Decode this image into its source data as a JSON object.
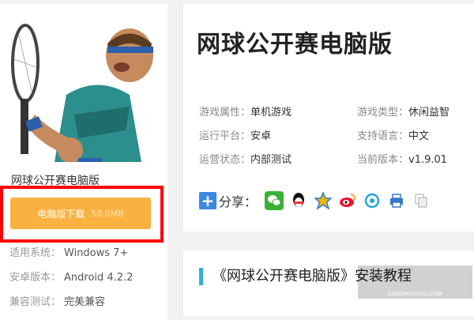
{
  "game": {
    "name": "网球公开赛电脑版",
    "download_label": "电脑版下载",
    "download_size": "50.0MB"
  },
  "side_info": [
    {
      "key": "适用系统：",
      "value": "Windows 7+"
    },
    {
      "key": "安卓版本：",
      "value": "Android 4.2.2"
    },
    {
      "key": "兼容测试：",
      "value": "完美兼容"
    }
  ],
  "header": {
    "title": "网球公开赛电脑版"
  },
  "attributes": [
    {
      "key": "游戏属性：",
      "value": "单机游戏"
    },
    {
      "key": "游戏类型：",
      "value": "休闲益智"
    },
    {
      "key": "运行平台：",
      "value": "安卓"
    },
    {
      "key": "支持语言：",
      "value": "中文"
    },
    {
      "key": "运营状态：",
      "value": "内部测试"
    },
    {
      "key": "当前版本：",
      "value": "v1.9.01"
    }
  ],
  "share": {
    "label": "分享：",
    "icons": [
      "wechat-icon",
      "qq-icon",
      "qzone-icon",
      "weibo-icon",
      "tencent-weibo-icon",
      "print-icon",
      "copy-icon"
    ]
  },
  "article": {
    "title": "《网球公开赛电脑版》安装教程"
  },
  "watermark": {
    "brand": "GAOSHOUYOU.COM"
  },
  "colors": {
    "download": "#f9b23f",
    "highlight": "#ff0000",
    "accent": "#2bb2d6"
  }
}
